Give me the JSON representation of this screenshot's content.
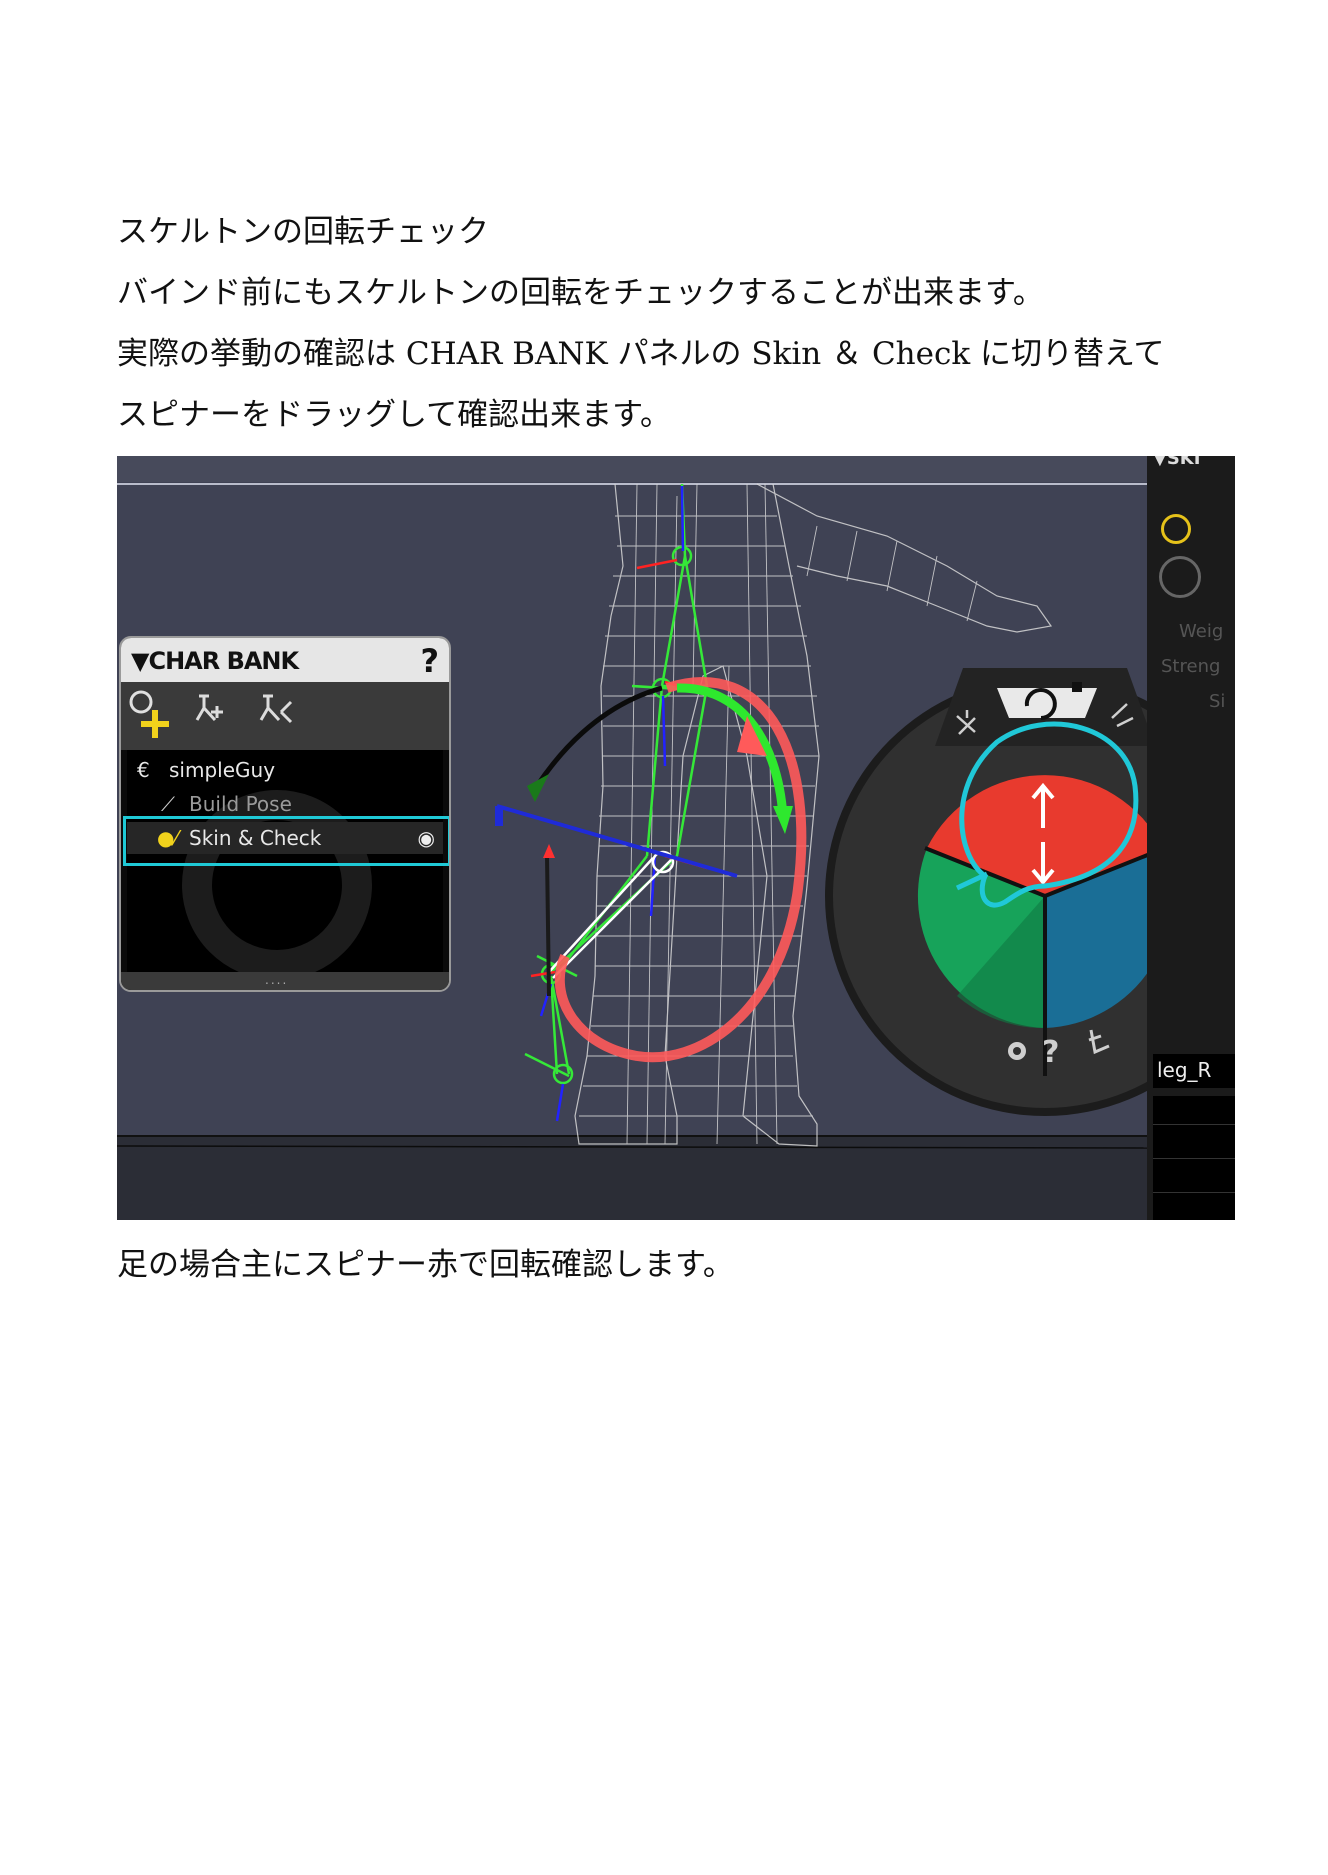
{
  "text": {
    "heading": "スケルトンの回転チェック",
    "line1": "バインド前にもスケルトンの回転をチェックすることが出来ます。",
    "line2": "実際の挙動の確認は CHAR BANK パネルの Skin ＆ Check に切り替えて",
    "line3": "スピナーをドラッグして確認出来ます。",
    "caption": "足の場合主にスピナー赤で回転確認します。"
  },
  "screenshot": {
    "char_bank": {
      "title": "▼CHAR BANK",
      "help": "?",
      "items": [
        {
          "label": "simpleGuy",
          "icon": "character-icon"
        },
        {
          "label": "Build Pose",
          "icon": "bone-icon"
        },
        {
          "label": "Skin & Check",
          "icon": "skin-check-icon",
          "selected": true,
          "visible_icon": "eye-icon"
        }
      ],
      "grip": "....",
      "toolbar_icons": [
        "add-character-icon",
        "skeleton-add-icon",
        "skeleton-remove-icon"
      ]
    },
    "right_panel": {
      "header": "▼SKI",
      "labels": [
        "Weig",
        "Streng",
        "Si"
      ],
      "bone_name": "leg_R"
    },
    "spinner": {
      "segments": [
        "red",
        "green",
        "blue"
      ],
      "bottom_icons": [
        "gear-icon",
        "help-icon",
        "axis-icon"
      ],
      "help_label": "?"
    },
    "colors": {
      "highlight": "#1fc9d6",
      "spinner_red": "#e83a2e",
      "spinner_green": "#17a35a",
      "spinner_blue": "#1a6e96",
      "background": "#3f4254"
    }
  }
}
